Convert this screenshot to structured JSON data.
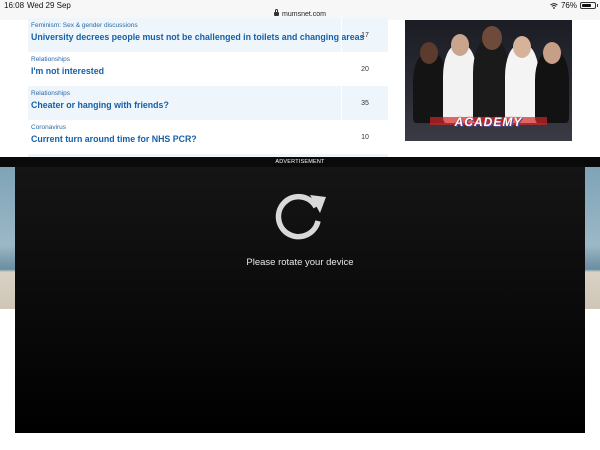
{
  "status_bar": {
    "time": "16:08",
    "date": "Wed 29 Sep",
    "url": "mumsnet.com",
    "battery": "76%",
    "battery_level": 0.76
  },
  "threads": [
    {
      "category": "Feminism: Sex & gender discussions",
      "title": "University decrees people must not be challenged in toilets and changing areas",
      "replies": "17"
    },
    {
      "category": "Relationships",
      "title": "I'm not interested",
      "replies": "20"
    },
    {
      "category": "Relationships",
      "title": "Cheater or hanging with friends?",
      "replies": "35"
    },
    {
      "category": "Coronavirus",
      "title": "Current turn around time for NHS PCR?",
      "replies": "10"
    }
  ],
  "side_ad": {
    "logo_text": "ACADEMY"
  },
  "advert": {
    "label": "ADVERTISEMENT",
    "message": "Please rotate your device",
    "icon": "rotate-icon"
  },
  "colors": {
    "link": "#1560a8",
    "category": "#2a6aa5",
    "alt_row": "#eef5fb",
    "ad_bg": "#0d0d0d"
  }
}
